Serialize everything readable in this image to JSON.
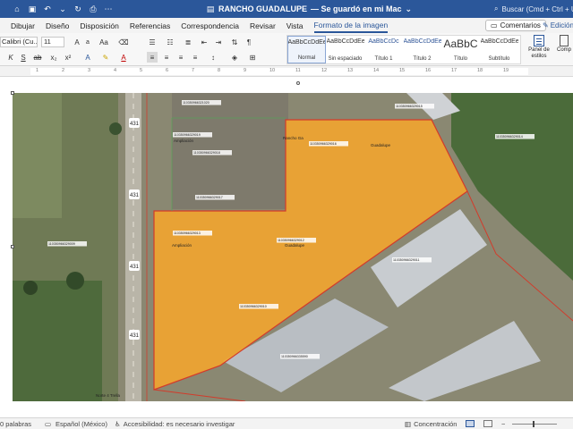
{
  "titlebar": {
    "title": "RANCHO GUADALUPE",
    "save_status": "— Se guardó en mi Mac",
    "search_placeholder": "Buscar (Cmd + Ctrl + U)",
    "bg_color": "#2b579a"
  },
  "menu": {
    "tabs": [
      "Dibujar",
      "Diseño",
      "Disposición",
      "Referencias",
      "Correspondencia",
      "Revisar",
      "Vista",
      "Formato de la imagen"
    ],
    "active_tab": "Formato de la imagen",
    "comments_label": "Comentarios",
    "edit_label": "Edición"
  },
  "ribbon": {
    "font_name": "Calibri (Cu...",
    "font_size": "11",
    "styles": [
      {
        "sample": "AaBbCcDdEe",
        "name": "Normal"
      },
      {
        "sample": "AaBbCcDdEe",
        "name": "Sin espaciado"
      },
      {
        "sample": "AaBbCcDc",
        "name": "Título 1"
      },
      {
        "sample": "AaBbCcDdEe",
        "name": "Título 2"
      },
      {
        "sample": "AaBbC",
        "name": "Título"
      },
      {
        "sample": "AaBbCcDdEe",
        "name": "Subtítulo"
      }
    ],
    "active_style": "Normal",
    "panel_label": "Panel de estilos",
    "comp_label": "Comp"
  },
  "ruler": {
    "numbers": [
      "1",
      "2",
      "3",
      "4",
      "5",
      "6",
      "7",
      "8",
      "9",
      "10",
      "11",
      "12",
      "13",
      "14",
      "15",
      "16",
      "17",
      "18",
      "19"
    ]
  },
  "map": {
    "highway_label": "431",
    "parcel_color": "#f5a52c",
    "boundary_color": "#d23b2b",
    "parcel_labels": [
      "110350966321020",
      "110350966329019",
      "110350966329018",
      "110350966329017",
      "110350966329016",
      "110350966329015",
      "110350966329014",
      "110350966329013",
      "110350966329012",
      "110350966329011",
      "110350966329010",
      "110350966329009",
      "110350966335590"
    ],
    "small_labels": [
      "Ampliación",
      "Rancho Ga",
      "Guadalupe",
      "Ampliación",
      "Guadalupe",
      "Norte 4 Trella"
    ]
  },
  "status": {
    "words": "0 palabras",
    "language": "Español (México)",
    "accessibility": "Accesibilidad: es necesario investigar",
    "focus": "Concentración"
  }
}
